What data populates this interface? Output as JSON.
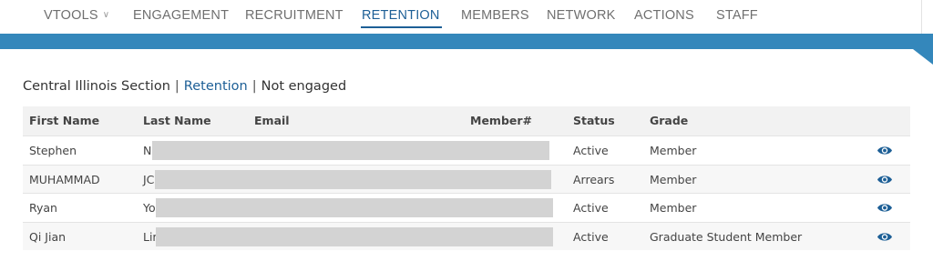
{
  "nav": {
    "items": [
      {
        "label": "VTOOLS",
        "dropdown": true,
        "active": false
      },
      {
        "label": "ENGAGEMENT",
        "active": false
      },
      {
        "label": "RECRUITMENT",
        "active": false
      },
      {
        "label": "RETENTION",
        "active": true
      },
      {
        "label": "MEMBERS",
        "active": false
      },
      {
        "label": "NETWORK",
        "active": false
      },
      {
        "label": "ACTIONS",
        "active": false
      },
      {
        "label": "STAFF",
        "active": false
      }
    ]
  },
  "breadcrumb": {
    "section": "Central Illinois Section",
    "separator": "|",
    "link": "Retention",
    "current": "Not engaged"
  },
  "table": {
    "columns": {
      "first_name": "First Name",
      "last_name": "Last Name",
      "email": "Email",
      "member_no": "Member#",
      "status": "Status",
      "grade": "Grade"
    },
    "rows": [
      {
        "first_name": "Stephen",
        "last_name": "N",
        "status": "Active",
        "grade": "Member"
      },
      {
        "first_name": "MUHAMMAD",
        "last_name": "JC",
        "status": "Arrears",
        "grade": "Member"
      },
      {
        "first_name": "Ryan",
        "last_name": "Yo",
        "status": "Active",
        "grade": "Member"
      },
      {
        "first_name": "Qi Jian",
        "last_name": "Lir",
        "status": "Active",
        "grade": "Graduate Student Member"
      }
    ]
  },
  "icons": {
    "row_action": "eye-icon",
    "dropdown": "chevron-down-icon"
  },
  "colors": {
    "accent": "#1d5f96",
    "band": "#3487bb",
    "redaction": "#d3d3d3"
  }
}
